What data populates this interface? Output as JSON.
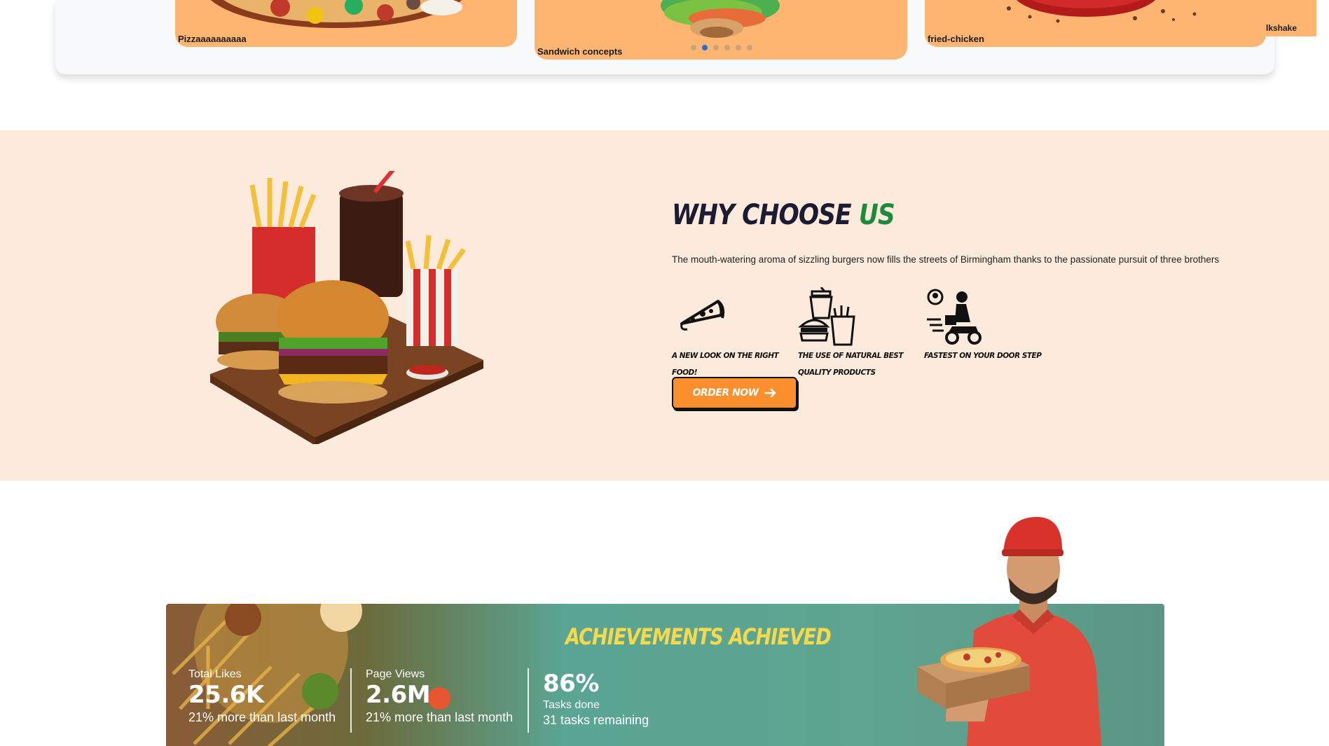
{
  "carousel": {
    "cards": [
      {
        "label": "Pizzaaaaaaaaaa"
      },
      {
        "label": "Sandwich concepts"
      },
      {
        "label": "fried-chicken"
      },
      {
        "label": "lkshake"
      }
    ],
    "dots_count": 6,
    "active_dot": 2
  },
  "why": {
    "title_main": "WHY CHOOSE ",
    "title_accent": "US",
    "description": "The mouth-watering aroma of sizzling burgers now fills the streets of Birmingham thanks to the passionate pursuit of three brothers",
    "features": [
      {
        "icon": "pizza-slice-icon",
        "label": "A new look on the right food!"
      },
      {
        "icon": "burger-fries-drink-icon",
        "label": "The use of natural best quality products"
      },
      {
        "icon": "delivery-scooter-icon",
        "label": "Fastest on your door step"
      }
    ],
    "order_button": "ORDER NOW",
    "order_icon": "arrow-right-icon",
    "image": "burger-fries-platter-image"
  },
  "achievements": {
    "title": "ACHIEVEMENTS ACHIEVED",
    "stats": [
      {
        "label": "Total Likes",
        "value": "25.6K",
        "sub": "21% more than last month"
      },
      {
        "label": "Page Views",
        "value": "2.6M",
        "sub": "21% more than last month"
      },
      {
        "value": "86%",
        "label": "Tasks done",
        "sub": "31 tasks remaining"
      }
    ],
    "image": "delivery-man-with-pizza-image"
  },
  "colors": {
    "card_orange": "#fdb571",
    "why_bg": "#fcebdc",
    "accent_green": "#1e8a3c",
    "button_orange": "#fb8f2e",
    "achievement_yellow": "#f7d94c",
    "teal": "#5fa591"
  }
}
